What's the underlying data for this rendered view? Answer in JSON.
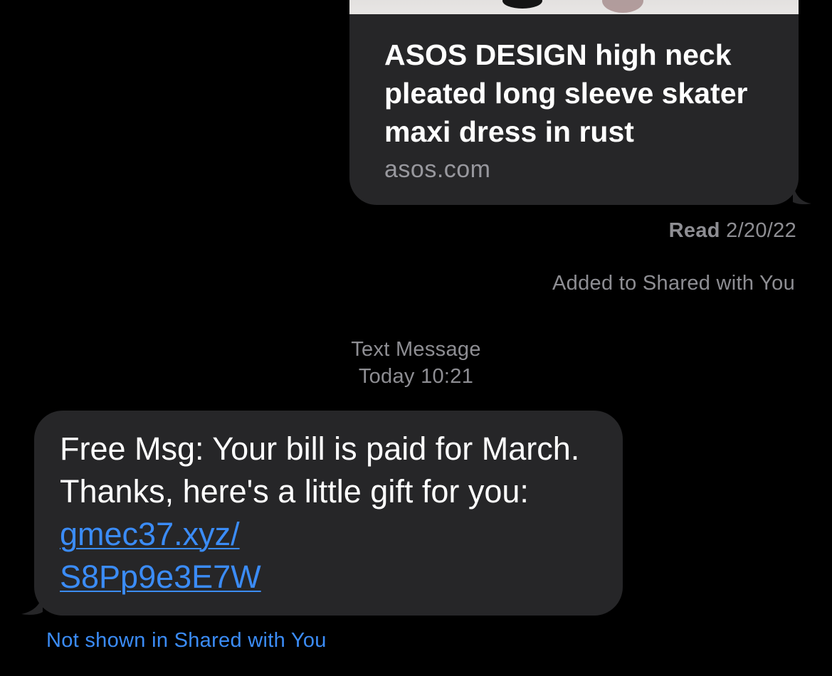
{
  "colors": {
    "background": "#000000",
    "bubble": "#262628",
    "secondary_text": "#8e8e93",
    "link_blue": "#3b8cf7"
  },
  "outgoing_link_preview": {
    "title": "ASOS DESIGN high neck pleated long sleeve skater maxi dress in rust",
    "domain": "asos.com"
  },
  "read_receipt": {
    "label": "Read",
    "date": "2/20/22"
  },
  "shared_status": "Added to Shared with You",
  "timestamp": {
    "service": "Text Message",
    "time": "Today 10:21"
  },
  "incoming_message": {
    "text_before_link": "Free Msg: Your bill is paid for March. Thanks, here's a little gift for you: ",
    "link_part_1": "gmec37.xyz/",
    "link_part_2": "S8Pp9e3E7W"
  },
  "incoming_shared_status": "Not shown in Shared with You"
}
